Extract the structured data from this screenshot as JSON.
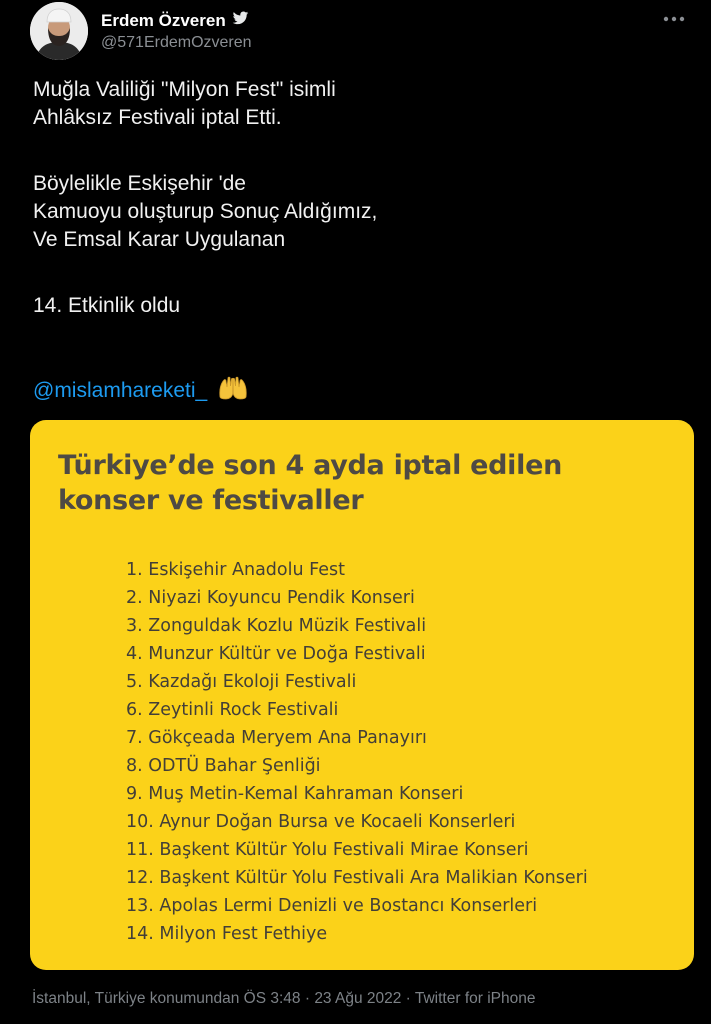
{
  "author": {
    "name": "Erdem Özveren",
    "handle": "@571ErdemOzveren",
    "verified_icon": "twitter-bird-icon",
    "more_icon": "more-dots-icon"
  },
  "tweet": {
    "lines": [
      "Muğla Valiliği \"Milyon Fest\" isimli",
      "Ahlâksız Festivali iptal Etti.",
      "Böylelikle Eskişehir 'de",
      "Kamuoyu oluşturup Sonuç Aldığımız,",
      "Ve Emsal Karar Uygulanan",
      "14. Etkinlik oldu"
    ],
    "mention": "@mislamhareketi_",
    "emoji_icon": "raised-hands-icon"
  },
  "card": {
    "background": "#fbd219",
    "title_line1": "Türkiye’de son 4 ayda iptal edilen",
    "title_line2": "konser ve festivaller",
    "items": [
      "1.   Eskişehir Anadolu Fest",
      "2.   Niyazi Koyuncu Pendik Konseri",
      "3.   Zonguldak Kozlu Müzik Festivali",
      "4.   Munzur Kültür ve Doğa Festivali",
      "5.   Kazdağı Ekoloji Festivali",
      "6.   Zeytinli Rock Festivali",
      "7.   Gökçeada Meryem Ana Panayırı",
      "8.   ODTÜ Bahar Şenliği",
      "9.   Muş Metin-Kemal Kahraman Konseri",
      "10.  Aynur Doğan Bursa ve Kocaeli Konserleri",
      "11.  Başkent Kültür Yolu Festivali Mirae Konseri",
      "12. Başkent Kültür Yolu Festivali Ara Malikian Konseri",
      "13. Apolas Lermi Denizli ve Bostancı Konserleri",
      "14. Milyon Fest Fethiye"
    ]
  },
  "footer": {
    "meta": "İstanbul, Türkiye konumundan ÖS 3:48 · 23 Ağu 2022 · Twitter for iPhone"
  }
}
